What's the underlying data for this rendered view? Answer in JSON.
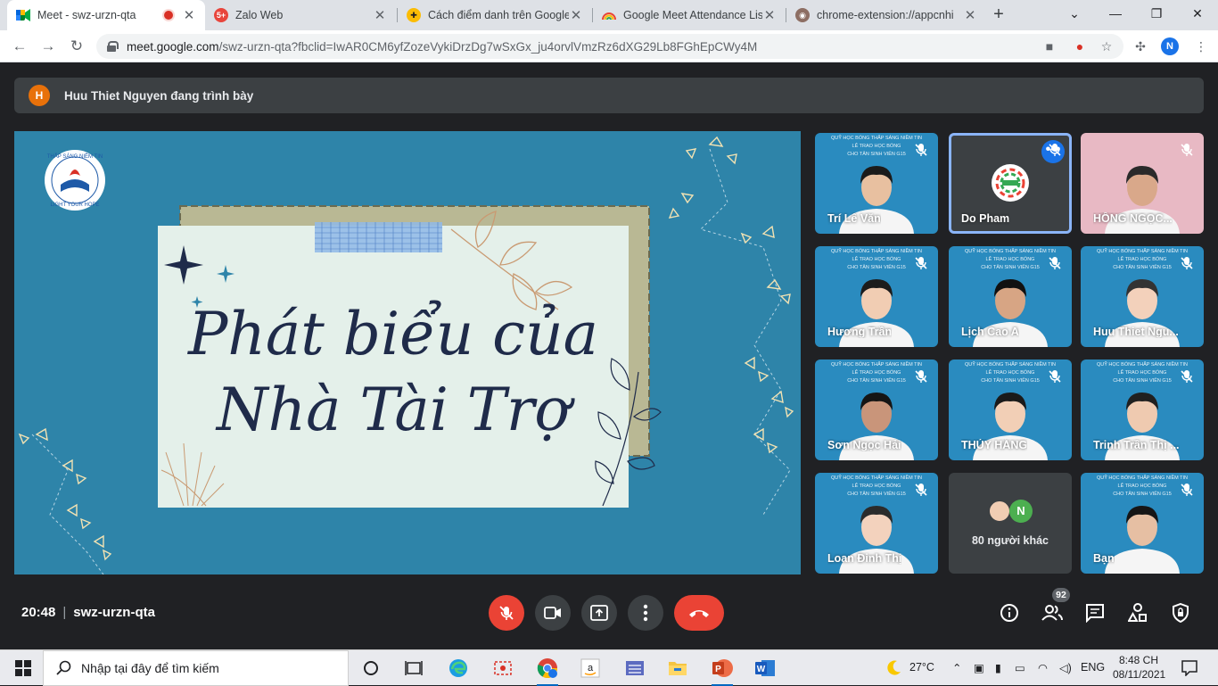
{
  "browser": {
    "tabs": [
      {
        "title": "Meet - swz-urzn-qta",
        "active": true
      },
      {
        "title": "Zalo Web"
      },
      {
        "title": "Cách điểm danh trên Google"
      },
      {
        "title": "Google Meet Attendance List"
      },
      {
        "title": "chrome-extension://appcnhi"
      }
    ],
    "new_tab": "+",
    "url_host": "meet.google.com",
    "url_rest": "/swz-urzn-qta?fbclid=IwAR0CM6yfZozeVykiDrzDg7wSxGx_ju4orvlVmzRz6dXG29Lb8FGhEpCWy4M",
    "profile_initial": "N"
  },
  "meet": {
    "presenter_initial": "H",
    "presenting_text": "Huu Thiet Nguyen đang trình bày",
    "slide": {
      "logo_text_top": "THẮP SÁNG NIỀM TIN",
      "logo_text_bottom": "LIGHT YOUR HOPE",
      "heading_line1": "Phát biểu của",
      "heading_line2": "Nhà Tài Trợ"
    },
    "tile_bg_line1": "QUỸ HỌC BỔNG THẮP SÁNG NIỀM TIN",
    "tile_bg_line2": "LỄ TRAO HỌC BỔNG",
    "tile_bg_line3": "CHO TÂN SINH VIÊN G15",
    "participants": [
      {
        "name": "Trí Lê Văn"
      },
      {
        "name": "Do Pham"
      },
      {
        "name": "HỒNG NGỌC..."
      },
      {
        "name": "Hương Trần"
      },
      {
        "name": "Lịch Cao A"
      },
      {
        "name": "Huu Thiet Ngu..."
      },
      {
        "name": "Sơn Ngọc Hải"
      },
      {
        "name": "THÚY HẰNG"
      },
      {
        "name": "Trinh Trần Thị ..."
      },
      {
        "name": "Loan Đinh Thị"
      },
      {
        "name": "80 người khác",
        "avatar_initial": "N"
      },
      {
        "name": "Bạn"
      }
    ],
    "time": "20:48",
    "meeting_code": "swz-urzn-qta",
    "participant_count": "92"
  },
  "taskbar": {
    "search_placeholder": "Nhập tại đây để tìm kiếm",
    "temperature": "27°C",
    "language": "ENG",
    "time": "8:48 CH",
    "date": "08/11/2021"
  }
}
